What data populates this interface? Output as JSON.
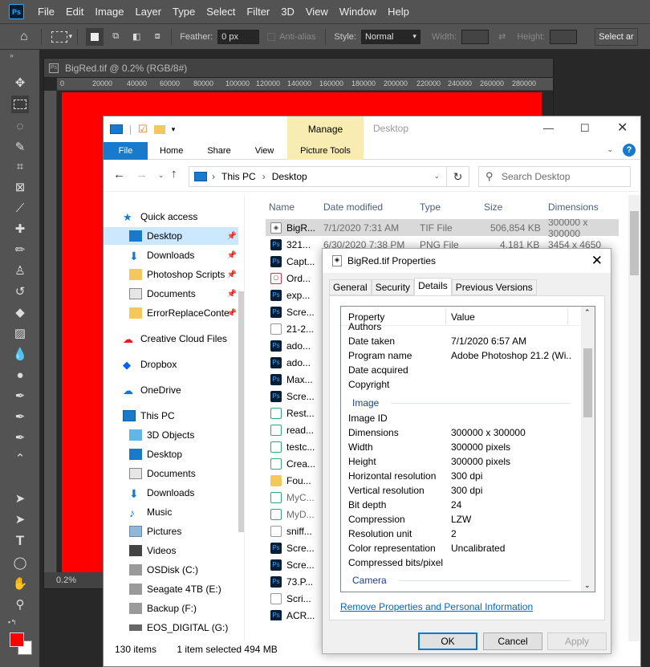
{
  "photoshop": {
    "logo": "Ps",
    "menu": [
      "File",
      "Edit",
      "Image",
      "Layer",
      "Type",
      "Select",
      "Filter",
      "3D",
      "View",
      "Window",
      "Help"
    ],
    "options": {
      "feather_label": "Feather:",
      "feather_value": "0 px",
      "antialias_label": "Anti-alias",
      "style_label": "Style:",
      "style_value": "Normal",
      "width_label": "Width:",
      "height_label": "Height:",
      "select_mask": "Select ar"
    },
    "document": {
      "tab_title": "BigRed.tif @ 0.2% (RGB/8#)",
      "ruler_ticks": [
        "0",
        "20000",
        "40000",
        "60000",
        "80000",
        "100000",
        "120000",
        "140000",
        "160000",
        "180000",
        "200000",
        "220000",
        "240000",
        "260000",
        "280000"
      ],
      "zoom": "0.2%",
      "canvas_color": "#ff0000"
    },
    "tool_icons": [
      "move-icon",
      "marquee-icon",
      "lasso-icon",
      "quick-select-icon",
      "crop-icon",
      "frame-icon",
      "eyedropper-icon",
      "healing-icon",
      "brush-icon",
      "stamp-icon",
      "history-brush-icon",
      "eraser-icon",
      "gradient-icon",
      "blur-icon",
      "dodge-icon",
      "pen-icon",
      "type-icon",
      "path-select-icon",
      "shape-icon",
      "hand-icon",
      "zoom-icon"
    ],
    "fg_color": "#ff0000",
    "bg_color": "#ffffff"
  },
  "explorer": {
    "title": "Desktop",
    "manage_tab": "Manage",
    "ribbon": {
      "file": "File",
      "tabs": [
        "Home",
        "Share",
        "View"
      ],
      "picture_tools": "Picture Tools"
    },
    "breadcrumb": [
      "This PC",
      "Desktop"
    ],
    "search_placeholder": "Search Desktop",
    "nav": [
      {
        "label": "Quick access"
      },
      {
        "label": "Desktop"
      },
      {
        "label": "Downloads"
      },
      {
        "label": "Photoshop Scripts"
      },
      {
        "label": "Documents"
      },
      {
        "label": "ErrorReplaceConte"
      },
      {
        "label": "Creative Cloud Files"
      },
      {
        "label": "Dropbox"
      },
      {
        "label": "OneDrive"
      },
      {
        "label": "This PC"
      },
      {
        "label": "3D Objects"
      },
      {
        "label": "Desktop"
      },
      {
        "label": "Documents"
      },
      {
        "label": "Downloads"
      },
      {
        "label": "Music"
      },
      {
        "label": "Pictures"
      },
      {
        "label": "Videos"
      },
      {
        "label": "OSDisk (C:)"
      },
      {
        "label": "Seagate 4TB (E:)"
      },
      {
        "label": "Backup (F:)"
      },
      {
        "label": "EOS_DIGITAL (G:)"
      }
    ],
    "columns": [
      "Name",
      "Date modified",
      "Type",
      "Size",
      "Dimensions"
    ],
    "files": [
      {
        "name": "BigR...",
        "date": "7/1/2020 7:31 AM",
        "type": "TIF File",
        "size": "506,854 KB",
        "dims": "300000 x 300000"
      },
      {
        "name": "321...",
        "date": "6/30/2020 7:38 PM",
        "type": "PNG File",
        "size": "4,181 KB",
        "dims": "3454 x 4650"
      },
      {
        "name": "Capt..."
      },
      {
        "name": "Ord..."
      },
      {
        "name": "exp..."
      },
      {
        "name": "Scre..."
      },
      {
        "name": "21-2..."
      },
      {
        "name": "ado..."
      },
      {
        "name": "ado..."
      },
      {
        "name": "Max..."
      },
      {
        "name": "Scre..."
      },
      {
        "name": "Rest..."
      },
      {
        "name": "read..."
      },
      {
        "name": "testc..."
      },
      {
        "name": "Crea..."
      },
      {
        "name": "Fou..."
      },
      {
        "name": "MyC..."
      },
      {
        "name": "MyD..."
      },
      {
        "name": "sniff..."
      },
      {
        "name": "Scre..."
      },
      {
        "name": "Scre..."
      },
      {
        "name": "73.P..."
      },
      {
        "name": "Scri..."
      },
      {
        "name": "ACR..."
      }
    ],
    "status_count": "130 items",
    "status_selected": "1 item selected  494 MB"
  },
  "properties": {
    "title": "BigRed.tif Properties",
    "tabs": [
      "General",
      "Security",
      "Details",
      "Previous Versions"
    ],
    "header": {
      "property": "Property",
      "value": "Value"
    },
    "rows_top": [
      {
        "k": "Authors",
        "v": ""
      },
      {
        "k": "Date taken",
        "v": "7/1/2020 6:57 AM"
      },
      {
        "k": "Program name",
        "v": "Adobe Photoshop 21.2 (Wi..."
      },
      {
        "k": "Date acquired",
        "v": ""
      },
      {
        "k": "Copyright",
        "v": ""
      }
    ],
    "group_image": "Image",
    "rows_image": [
      {
        "k": "Image ID",
        "v": ""
      },
      {
        "k": "Dimensions",
        "v": "300000 x 300000"
      },
      {
        "k": "Width",
        "v": "300000 pixels"
      },
      {
        "k": "Height",
        "v": "300000 pixels"
      },
      {
        "k": "Horizontal resolution",
        "v": "300 dpi"
      },
      {
        "k": "Vertical resolution",
        "v": "300 dpi"
      },
      {
        "k": "Bit depth",
        "v": "24"
      },
      {
        "k": "Compression",
        "v": "LZW"
      },
      {
        "k": "Resolution unit",
        "v": "2"
      },
      {
        "k": "Color representation",
        "v": "Uncalibrated"
      },
      {
        "k": "Compressed bits/pixel",
        "v": ""
      }
    ],
    "group_camera": "Camera",
    "remove_link": "Remove Properties and Personal Information",
    "buttons": {
      "ok": "OK",
      "cancel": "Cancel",
      "apply": "Apply"
    }
  }
}
